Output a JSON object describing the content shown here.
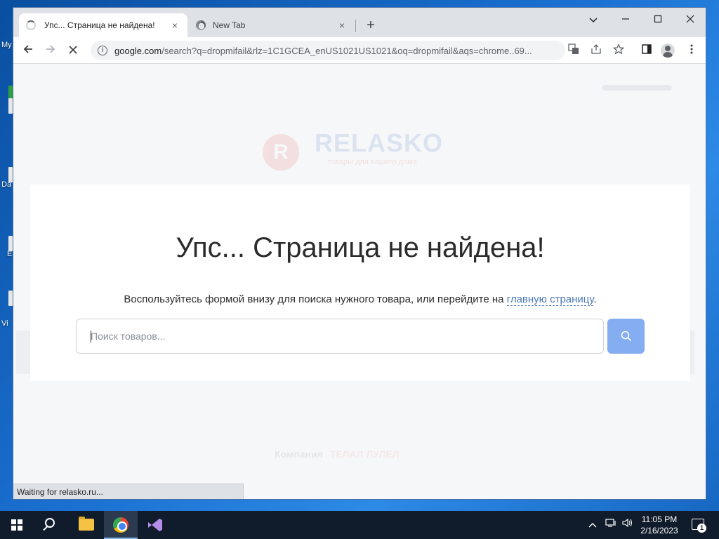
{
  "desktop": {
    "labels": [
      "My",
      "Da",
      "E",
      "Vi"
    ]
  },
  "browser": {
    "tabs": [
      {
        "label": "Упс... Страница не найдена!",
        "active": true
      },
      {
        "label": "New Tab",
        "active": false
      }
    ],
    "tab_close_glyph": "×",
    "new_tab_glyph": "+",
    "window_controls": {
      "dropdown": "⌄",
      "minimize": "—",
      "maximize": "☐",
      "close": "✕"
    },
    "address": {
      "host": "google.com",
      "rest": "/search?q=dropmifail&rlz=1C1GCEA_enUS1021US1021&oq=dropmifail&aqs=chrome..69..."
    },
    "status_text": "Waiting for relasko.ru..."
  },
  "page": {
    "logo": {
      "mark": "R",
      "name": "RELASKO",
      "tagline": "товары для вашего дома"
    },
    "heading": "Упс... Страница не найдена!",
    "subtext_before": "Воспользуйтесь формой внизу для поиска нужного товара, или перейдите на ",
    "subtext_link": "главную страницу",
    "subtext_after": ".",
    "search": {
      "placeholder": "Поиск товаров...",
      "value": ""
    },
    "footer": {
      "label": "Компания",
      "value": "ТЕЛАЛ ЛУЛЕЛ"
    }
  },
  "taskbar": {
    "clock_time": "11:05 PM",
    "clock_date": "2/16/2023",
    "notification_count": "1"
  },
  "colors": {
    "search_button": "#85aef2",
    "link": "#4a78b8",
    "taskbar": "#101b2b"
  }
}
